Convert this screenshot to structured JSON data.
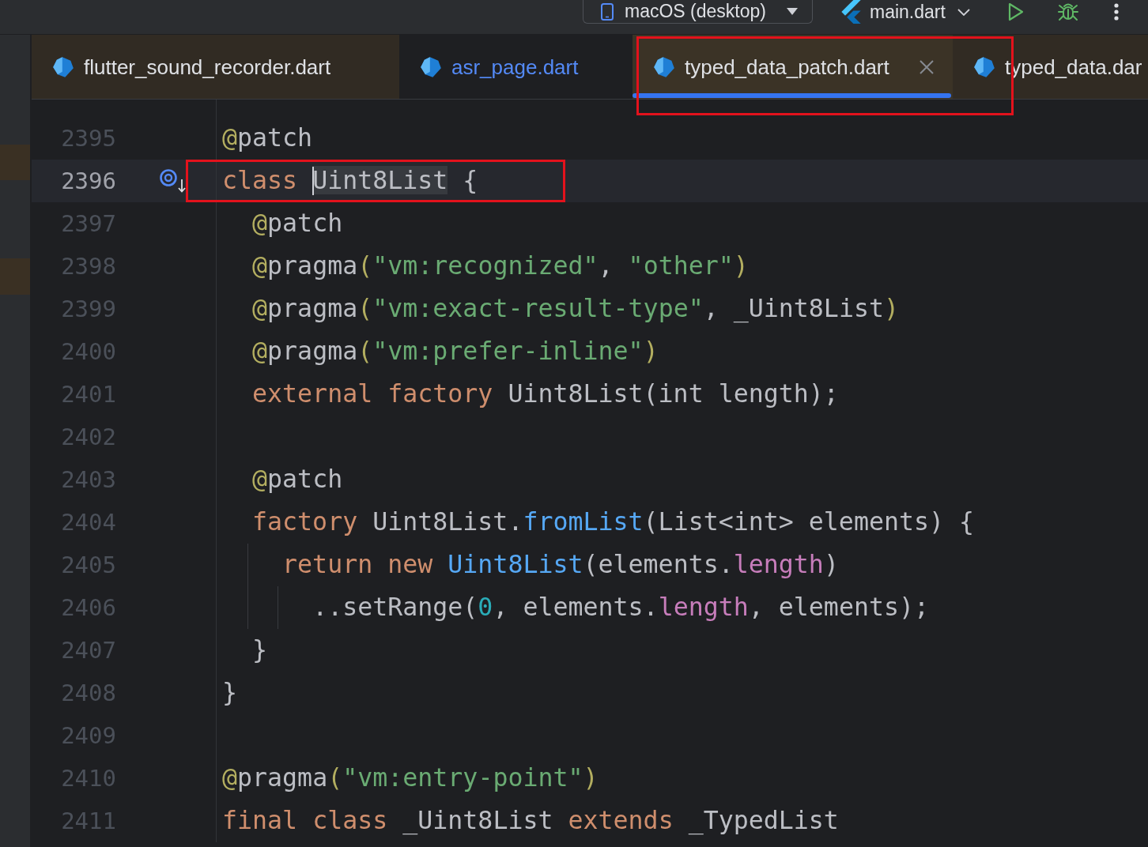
{
  "toolbar": {
    "device": "macOS (desktop)",
    "run_config": "main.dart"
  },
  "tabs": [
    {
      "label": "flutter_sound_recorder.dart",
      "selected": false,
      "modified": false,
      "library": true
    },
    {
      "label": "asr_page.dart",
      "selected": false,
      "modified": true,
      "library": false
    },
    {
      "label": "typed_data_patch.dart",
      "selected": true,
      "modified": false,
      "library": true,
      "outlined": true
    },
    {
      "label": "typed_data.dar",
      "selected": false,
      "modified": false,
      "library": true
    }
  ],
  "editor": {
    "lines": [
      {
        "number": "2395",
        "current": false,
        "tokens": [
          {
            "text": "@",
            "kind": "annotation"
          },
          {
            "text": "patch",
            "kind": "plain"
          }
        ]
      },
      {
        "number": "2396",
        "current": true,
        "outlined": true,
        "implementation_marker": true,
        "tokens": [
          {
            "text": "class ",
            "kind": "keyword"
          },
          {
            "text": "Uint8List",
            "kind": "plain",
            "highlighted": true,
            "caret": true
          },
          {
            "text": " {",
            "kind": "plain"
          }
        ],
        "children": [
          {
            "number": "2397",
            "current": false,
            "tokens": [
              {
                "text": "@",
                "kind": "annotation"
              },
              {
                "text": "patch",
                "kind": "plain"
              }
            ]
          },
          {
            "number": "2398",
            "current": false,
            "tokens": [
              {
                "text": "@",
                "kind": "annotation"
              },
              {
                "text": "pragma",
                "kind": "plain"
              },
              {
                "text": "(",
                "kind": "annotation"
              },
              {
                "text": "\"vm:recognized\"",
                "kind": "string"
              },
              {
                "text": ", ",
                "kind": "plain"
              },
              {
                "text": "\"other\"",
                "kind": "string"
              },
              {
                "text": ")",
                "kind": "annotation"
              }
            ]
          },
          {
            "number": "2399",
            "current": false,
            "tokens": [
              {
                "text": "@",
                "kind": "annotation"
              },
              {
                "text": "pragma",
                "kind": "plain"
              },
              {
                "text": "(",
                "kind": "annotation"
              },
              {
                "text": "\"vm:exact-result-type\"",
                "kind": "string"
              },
              {
                "text": ", _Uint8List",
                "kind": "plain"
              },
              {
                "text": ")",
                "kind": "annotation"
              }
            ]
          },
          {
            "number": "2400",
            "current": false,
            "tokens": [
              {
                "text": "@",
                "kind": "annotation"
              },
              {
                "text": "pragma",
                "kind": "plain"
              },
              {
                "text": "(",
                "kind": "annotation"
              },
              {
                "text": "\"vm:prefer-inline\"",
                "kind": "string"
              },
              {
                "text": ")",
                "kind": "annotation"
              }
            ]
          },
          {
            "number": "2401",
            "current": false,
            "tokens": [
              {
                "text": "external factory ",
                "kind": "keyword"
              },
              {
                "text": "Uint8List(int length);",
                "kind": "plain"
              }
            ]
          },
          {
            "number": "2402",
            "current": false
          },
          {
            "number": "2403",
            "current": false,
            "tokens": [
              {
                "text": "@",
                "kind": "annotation"
              },
              {
                "text": "patch",
                "kind": "plain"
              }
            ]
          },
          {
            "number": "2404",
            "current": false,
            "tokens": [
              {
                "text": "factory ",
                "kind": "keyword"
              },
              {
                "text": "Uint8List.",
                "kind": "plain"
              },
              {
                "text": "fromList",
                "kind": "call"
              },
              {
                "text": "(List<int> elements) {",
                "kind": "plain"
              }
            ],
            "children": [
              {
                "number": "2405",
                "current": false,
                "tokens": [
                  {
                    "text": "return new ",
                    "kind": "keyword"
                  },
                  {
                    "text": "Uint8List",
                    "kind": "call"
                  },
                  {
                    "text": "(elements.",
                    "kind": "plain"
                  },
                  {
                    "text": "length",
                    "kind": "field"
                  },
                  {
                    "text": ")",
                    "kind": "plain"
                  }
                ],
                "children": [
                  {
                    "number": "2406",
                    "current": false,
                    "tokens": [
                      {
                        "text": "..setRange(",
                        "kind": "plain"
                      },
                      {
                        "text": "0",
                        "kind": "number"
                      },
                      {
                        "text": ", elements.",
                        "kind": "plain"
                      },
                      {
                        "text": "length",
                        "kind": "field"
                      },
                      {
                        "text": ", elements);",
                        "kind": "plain"
                      }
                    ]
                  }
                ]
              }
            ]
          },
          {
            "number": "2407",
            "current": false,
            "tokens": [
              {
                "text": "}",
                "kind": "plain"
              }
            ]
          }
        ]
      },
      {
        "number": "2408",
        "current": false,
        "tokens": [
          {
            "text": "}",
            "kind": "plain"
          }
        ]
      },
      {
        "number": "2409",
        "current": false
      },
      {
        "number": "2410",
        "current": false,
        "tokens": [
          {
            "text": "@",
            "kind": "annotation"
          },
          {
            "text": "pragma",
            "kind": "plain"
          },
          {
            "text": "(",
            "kind": "annotation"
          },
          {
            "text": "\"vm:entry-point\"",
            "kind": "string"
          },
          {
            "text": ")",
            "kind": "annotation"
          }
        ]
      },
      {
        "number": "2411",
        "current": false,
        "tokens": [
          {
            "text": "final class ",
            "kind": "keyword"
          },
          {
            "text": "_Uint8List ",
            "kind": "plain"
          },
          {
            "text": "extends ",
            "kind": "keyword"
          },
          {
            "text": "_TypedList",
            "kind": "plain"
          }
        ]
      }
    ]
  }
}
